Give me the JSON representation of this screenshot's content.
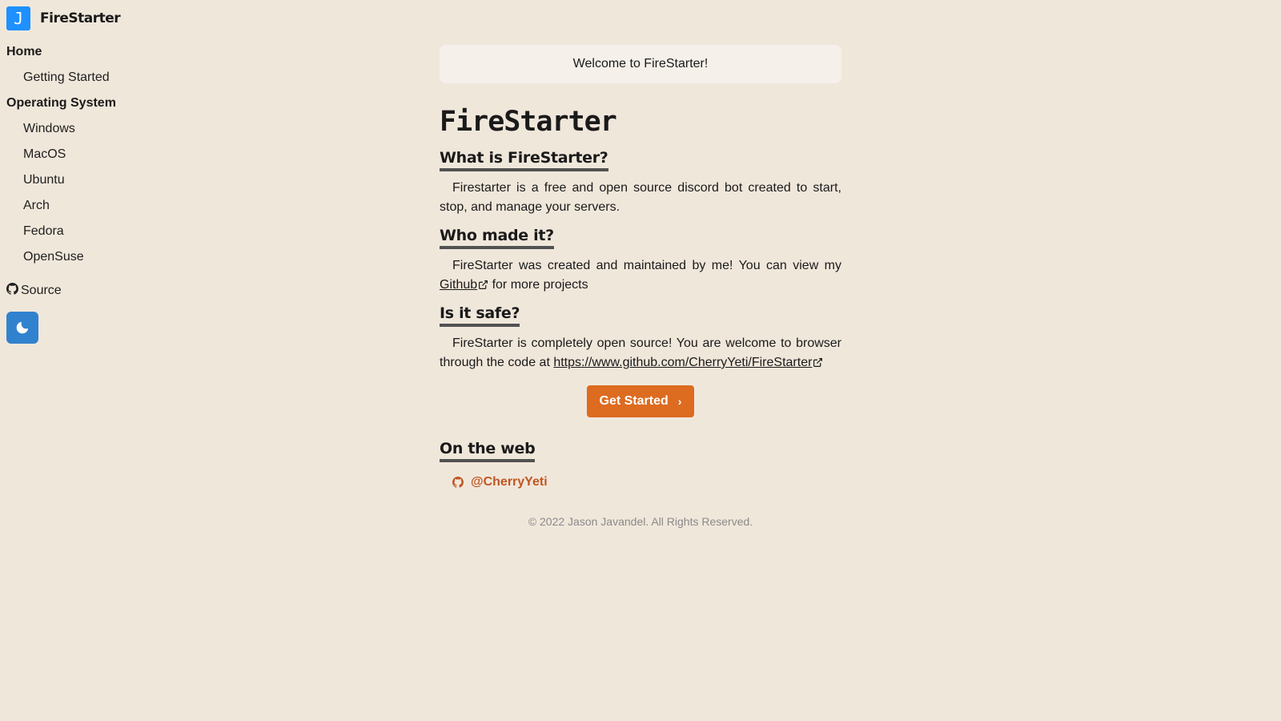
{
  "brand": {
    "logo_letter": "J",
    "name": "FireStarter"
  },
  "sidebar": {
    "sections": [
      {
        "label": "Home",
        "items": [
          "Getting Started"
        ]
      },
      {
        "label": "Operating System",
        "items": [
          "Windows",
          "MacOS",
          "Ubuntu",
          "Arch",
          "Fedora",
          "OpenSuse"
        ]
      }
    ],
    "source_label": "Source"
  },
  "main": {
    "welcome": "Welcome to FireStarter!",
    "title": "FireStarter",
    "sections": [
      {
        "heading": "What is FireStarter?",
        "text": "Firestarter is a free and open source discord bot created to start, stop, and manage your servers."
      },
      {
        "heading": "Who made it?",
        "text_before": "FireStarter was created and maintained by me! You can view my ",
        "link": "Github",
        "text_after": " for more projects"
      },
      {
        "heading": "Is it safe?",
        "text_before": "FireStarter is completely open source! You are welcome to browser through the code at ",
        "link": "https://www.github.com/CherryYeti/FireStarter"
      }
    ],
    "cta_label": "Get Started",
    "web_heading": "On the web",
    "web_handle": "@CherryYeti",
    "footer": "© 2022 Jason Javandel. All Rights Reserved."
  },
  "colors": {
    "accent_orange": "#dd6b20",
    "toggle_blue": "#3182ce",
    "logo_blue": "#1e90ff",
    "background": "#f0e7db"
  },
  "icons": {
    "source": "github-icon",
    "theme_toggle": "moon-icon",
    "external": "external-link-icon",
    "cta": "chevron-right-icon"
  }
}
